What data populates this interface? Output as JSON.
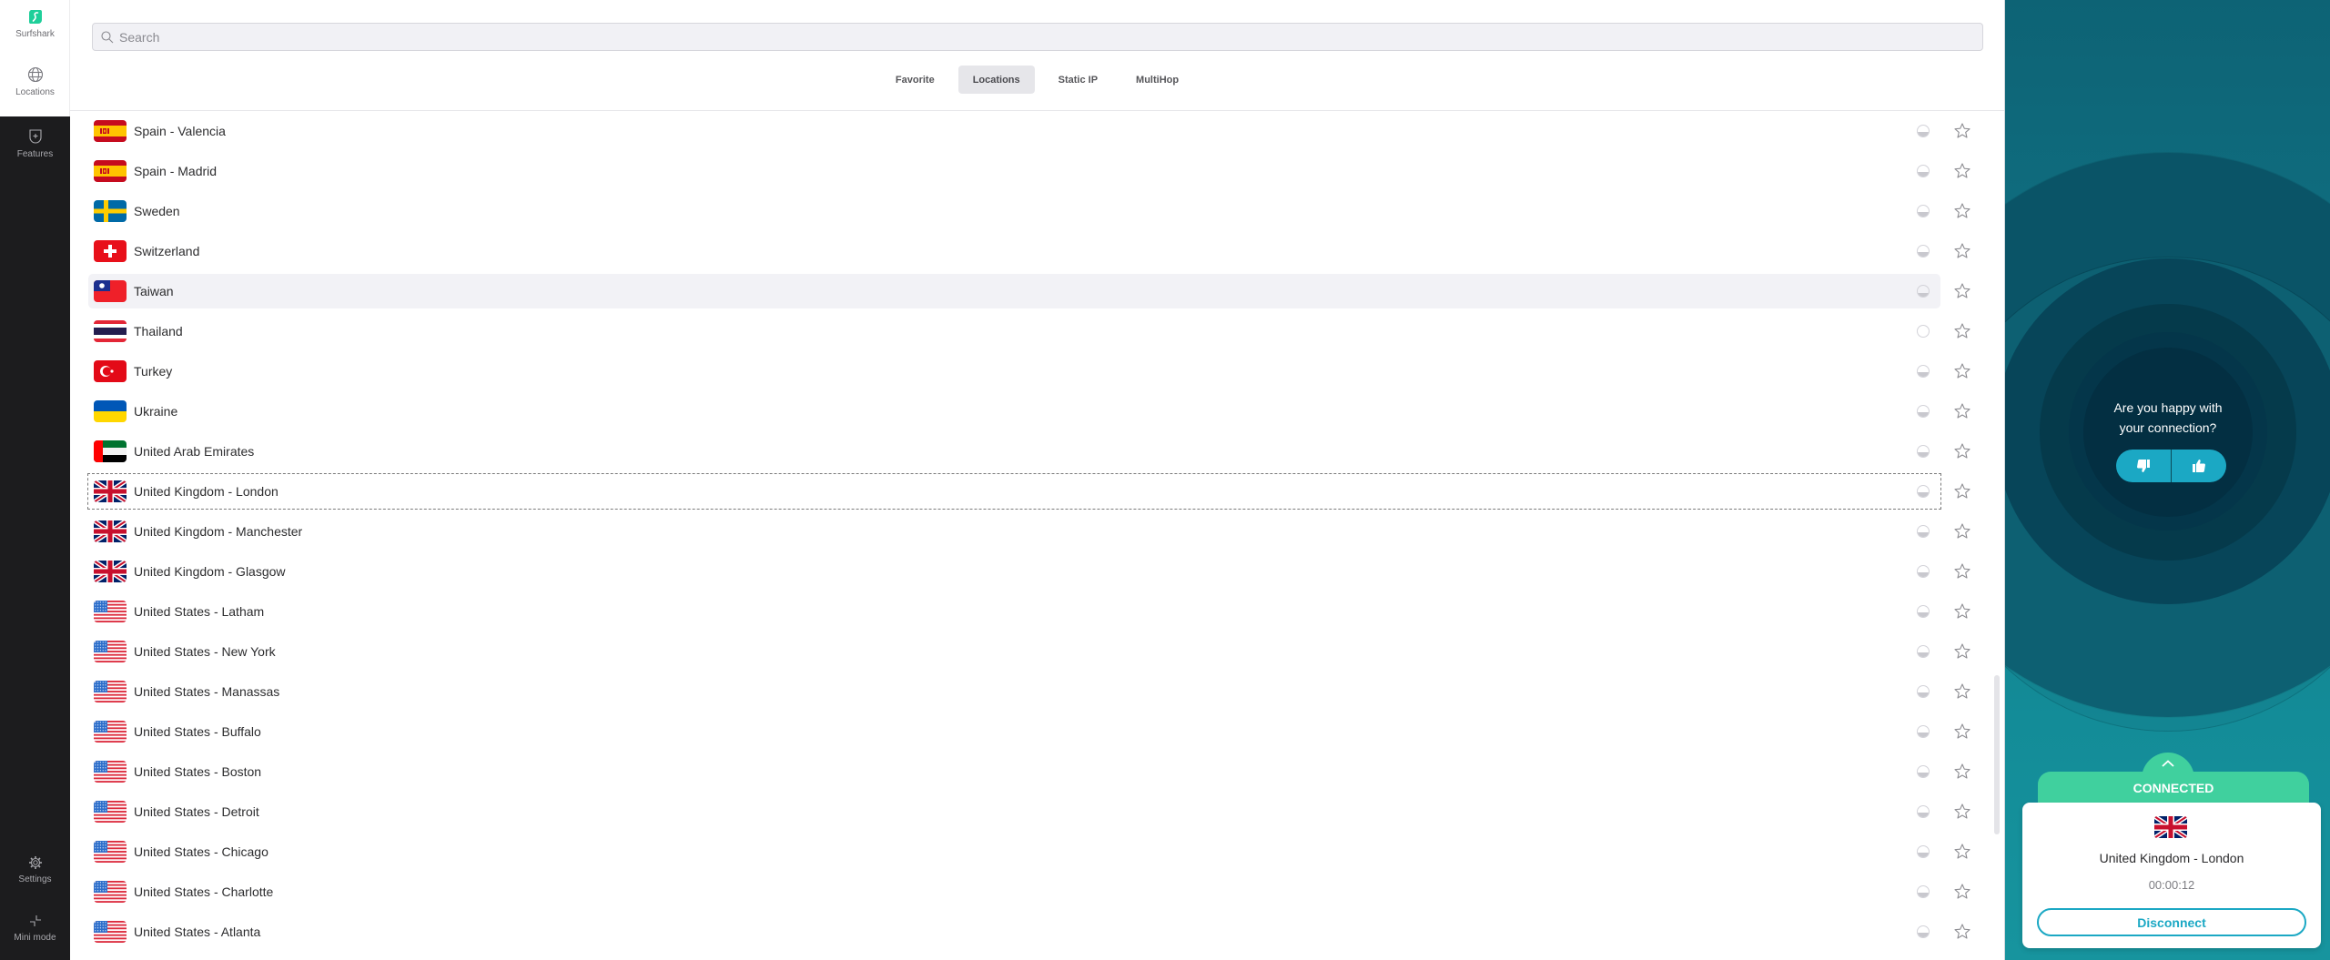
{
  "app": {
    "name": "Surfshark",
    "brand_color": "#1fcf9a",
    "accent_color": "#1ba8c4",
    "connected_color": "#40d09e"
  },
  "sidebar": {
    "top_items": [
      {
        "label": "Surfshark",
        "icon": "surfshark-logo-icon"
      },
      {
        "label": "Locations",
        "icon": "globe-icon"
      }
    ],
    "items": [
      {
        "label": "Features",
        "icon": "shield-plus-icon"
      }
    ],
    "bottom_items": [
      {
        "label": "Settings",
        "icon": "gear-icon"
      },
      {
        "label": "Mini mode",
        "icon": "minimize-icon"
      }
    ]
  },
  "search": {
    "placeholder": "Search",
    "value": ""
  },
  "tabs": [
    {
      "label": "Favorite",
      "active": false
    },
    {
      "label": "Locations",
      "active": true
    },
    {
      "label": "Static IP",
      "active": false
    },
    {
      "label": "MultiHop",
      "active": false
    }
  ],
  "locations": [
    {
      "name": "Spain - Valencia",
      "flag": "es",
      "load": "half",
      "state": ""
    },
    {
      "name": "Spain - Madrid",
      "flag": "es",
      "load": "half",
      "state": ""
    },
    {
      "name": "Sweden",
      "flag": "se",
      "load": "half",
      "state": ""
    },
    {
      "name": "Switzerland",
      "flag": "ch",
      "load": "half",
      "state": ""
    },
    {
      "name": "Taiwan",
      "flag": "tw",
      "load": "low",
      "state": "hover"
    },
    {
      "name": "Thailand",
      "flag": "th",
      "load": "empty",
      "state": ""
    },
    {
      "name": "Turkey",
      "flag": "tr",
      "load": "half",
      "state": ""
    },
    {
      "name": "Ukraine",
      "flag": "ua",
      "load": "half",
      "state": ""
    },
    {
      "name": "United Arab Emirates",
      "flag": "ae",
      "load": "half",
      "state": ""
    },
    {
      "name": "United Kingdom - London",
      "flag": "gb",
      "load": "half",
      "state": "focused"
    },
    {
      "name": "United Kingdom - Manchester",
      "flag": "gb",
      "load": "half",
      "state": ""
    },
    {
      "name": "United Kingdom - Glasgow",
      "flag": "gb",
      "load": "half",
      "state": ""
    },
    {
      "name": "United States - Latham",
      "flag": "us",
      "load": "half",
      "state": ""
    },
    {
      "name": "United States - New York",
      "flag": "us",
      "load": "half",
      "state": ""
    },
    {
      "name": "United States - Manassas",
      "flag": "us",
      "load": "half",
      "state": ""
    },
    {
      "name": "United States - Buffalo",
      "flag": "us",
      "load": "half",
      "state": ""
    },
    {
      "name": "United States - Boston",
      "flag": "us",
      "load": "half",
      "state": ""
    },
    {
      "name": "United States - Detroit",
      "flag": "us",
      "load": "half",
      "state": ""
    },
    {
      "name": "United States - Chicago",
      "flag": "us",
      "load": "half",
      "state": ""
    },
    {
      "name": "United States - Charlotte",
      "flag": "us",
      "load": "half",
      "state": ""
    },
    {
      "name": "United States - Atlanta",
      "flag": "us",
      "load": "half",
      "state": ""
    }
  ],
  "panel": {
    "feedback_question": "Are you happy with your connection?",
    "thumbs_down_icon": "thumbs-down-icon",
    "thumbs_up_icon": "thumbs-up-icon",
    "status": "CONNECTED",
    "connected_location": "United Kingdom - London",
    "connected_flag": "gb",
    "elapsed_time": "00:00:12",
    "disconnect_label": "Disconnect"
  }
}
